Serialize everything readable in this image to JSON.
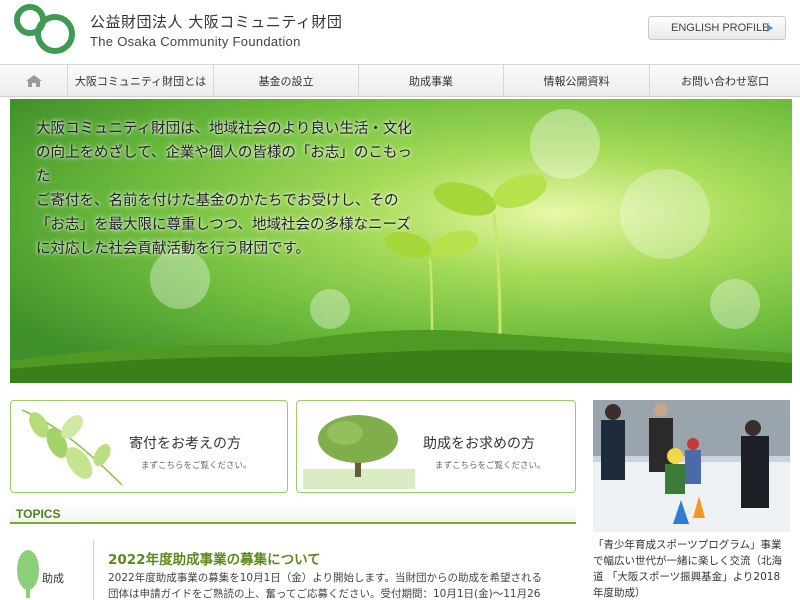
{
  "header": {
    "org_name_jp": "公益財団法人 大阪コミュニティ財団",
    "org_name_en": "The Osaka Community Foundation",
    "english_button": "ENGLISH PROFILE"
  },
  "nav": {
    "items": [
      {
        "label": "大阪コミュニティ財団とは"
      },
      {
        "label": "基金の設立"
      },
      {
        "label": "助成事業"
      },
      {
        "label": "情報公開資料"
      },
      {
        "label": "お問い合わせ窓口"
      }
    ]
  },
  "hero": {
    "lines": [
      "大阪コミュニティ財団は、地域社会のより良い生活・文化",
      "の向上をめざして、企業や個人の皆様の「お志」のこもった",
      "ご寄付を、名前を付けた基金のかたちでお受けし、その",
      "「お志」を最大限に尊重しつつ、地域社会の多様なニーズ",
      "に対応した社会貢献活動を行う財団です。"
    ]
  },
  "cards": {
    "donate": {
      "title": "寄付をお考えの方",
      "sub": "まずこちらをご覧ください。"
    },
    "grant": {
      "title": "助成をお求めの方",
      "sub": "まずこちらをご覧ください。"
    }
  },
  "photo": {
    "caption_lines": [
      "「青少年育成スポーツプログラム」事業",
      "で幅広い世代が一緒に楽しく交流（北海",
      "道 「大阪スポーツ振興基金」より2018",
      "年度助成）"
    ]
  },
  "topics": {
    "label": "TOPICS",
    "items": [
      {
        "category": "助成",
        "title": "2022年度助成事業の募集について",
        "body_lines": [
          "2022年度助成事業の募集を10月1日（金）より開始します。当財団からの助成を希望される",
          "団体は申請ガイドをご熟読の上、奮ってご応募ください。受付期間：10月1日(金)～11月26"
        ]
      }
    ]
  },
  "colors": {
    "brand_green": "#3e9a54",
    "accent_green": "#5b8a1f",
    "card_border": "#9ccc66"
  }
}
